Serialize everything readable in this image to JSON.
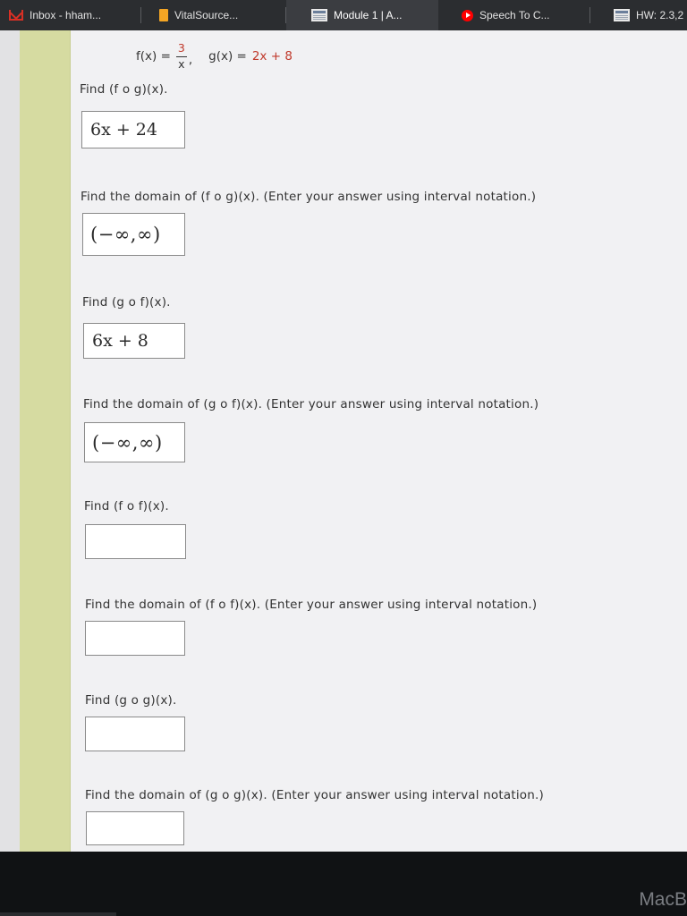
{
  "tabs": [
    {
      "label": "Inbox - hham...",
      "icon": "gmail-icon",
      "active": false
    },
    {
      "label": "VitalSource...",
      "icon": "vitalsource-icon",
      "active": false
    },
    {
      "label": "Module 1 | A...",
      "icon": "document-icon",
      "active": true
    },
    {
      "label": "Speech To C...",
      "icon": "youtube-icon",
      "active": false
    },
    {
      "label": "HW: 2.3,2",
      "icon": "document-icon",
      "active": false
    }
  ],
  "functions": {
    "f_lhs": "f(x) =",
    "f_num": "3",
    "f_den": "x",
    "comma": ",",
    "g_lhs": "g(x) =",
    "g_rhs": "2x + 8"
  },
  "questions": [
    {
      "prompt": "Find  (f o g)(x).",
      "answer": "6x + 24"
    },
    {
      "prompt": "Find the domain of  (f o g)(x).  (Enter your answer using interval notation.)",
      "answer": "(−∞,∞)"
    },
    {
      "prompt": "Find  (g o f)(x).",
      "answer": "6x + 8"
    },
    {
      "prompt": "Find the domain of  (g o f)(x).  (Enter your answer using interval notation.)",
      "answer": "(−∞,∞)"
    },
    {
      "prompt": "Find  (f o f)(x).",
      "answer": ""
    },
    {
      "prompt": "Find the domain of  (f o f)(x).  (Enter your answer using interval notation.)",
      "answer": ""
    },
    {
      "prompt": "Find  (g o g)(x).",
      "answer": ""
    },
    {
      "prompt": "Find the domain of  (g o g)(x).  (Enter your answer using interval notation.)",
      "answer": ""
    }
  ],
  "bezel": {
    "label": "MacB"
  },
  "colors": {
    "accent_red": "#c0392b",
    "rail": "#d6dba1"
  }
}
